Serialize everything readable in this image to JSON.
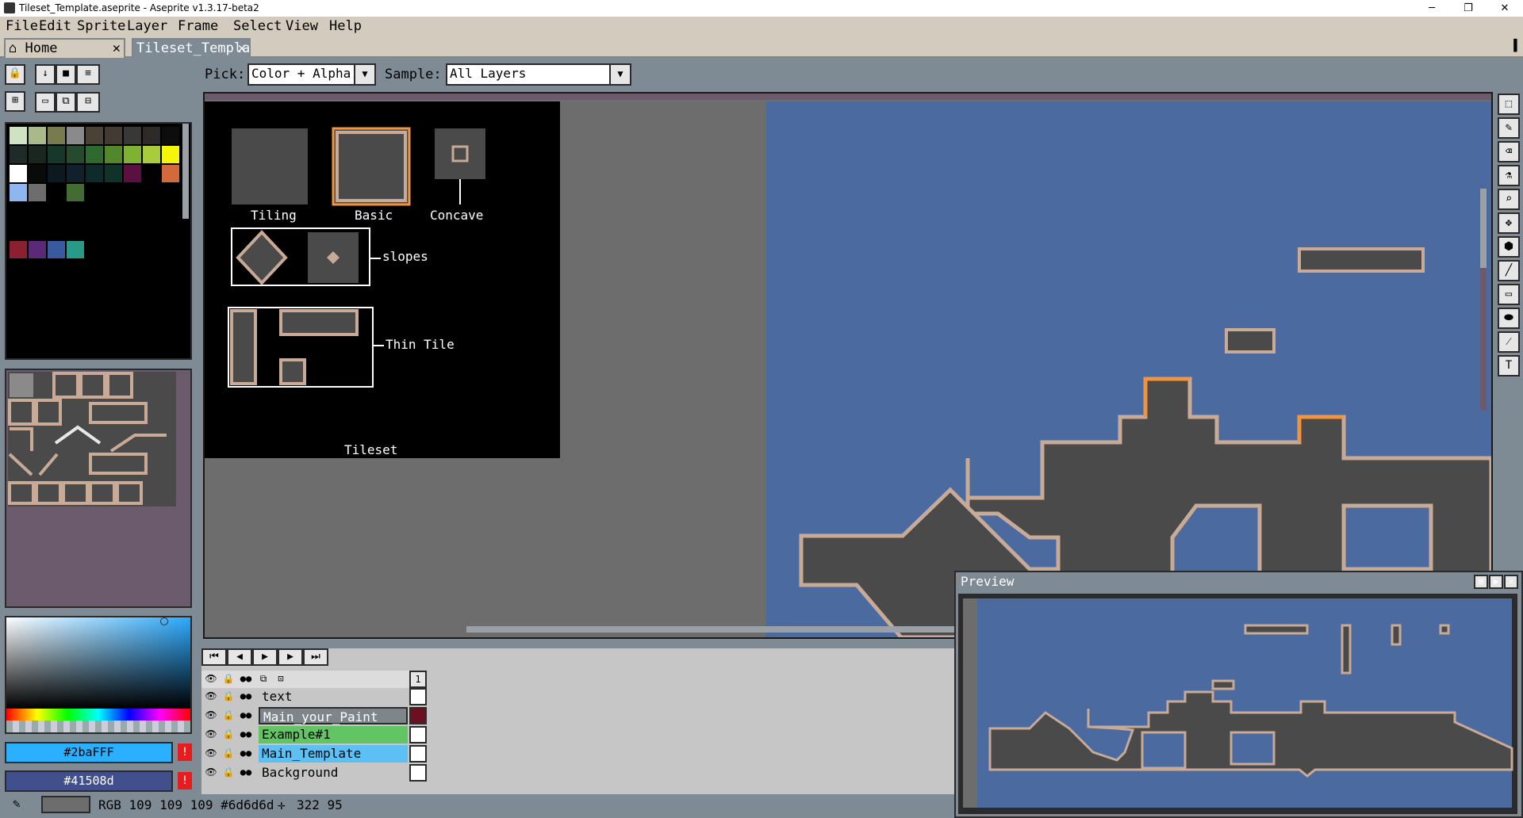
{
  "window": {
    "title": "Tileset_Template.aseprite - Aseprite v1.3.17-beta2",
    "minimize": "─",
    "maximize": "❐",
    "close": "✕"
  },
  "menu": [
    "File",
    "Edit",
    "Sprite",
    "Layer",
    "Frame",
    "Select",
    "View",
    "Help"
  ],
  "tabs": [
    {
      "label": "Home",
      "close": "✕"
    },
    {
      "label": "Tileset_Templa",
      "close": "✕"
    }
  ],
  "context_bar": {
    "pick_label": "Pick:",
    "pick_value": "Color + Alpha",
    "sample_label": "Sample:",
    "sample_value": "All Layers"
  },
  "sprite_labels": {
    "tiling": "Tiling",
    "basic": "Basic",
    "concave": "Concave",
    "slopes": "slopes",
    "thin_tile": "Thin Tile",
    "tileset": "Tileset"
  },
  "colors": {
    "sky": "#4a6aa0",
    "ground": "#4a4a4a",
    "outline": "#c8aa96",
    "orange": "#f29340",
    "fg_color": "#2baFFF",
    "bg_color": "#41508d"
  },
  "palette": {
    "fg_hex": "#2baFFF",
    "bg_hex": "#41508d",
    "warning": "!"
  },
  "timeline": {
    "frame_number": "1",
    "layers": [
      {
        "name": "text",
        "color": ""
      },
      {
        "name": "Main_your_Paint",
        "color": "#7e868c"
      },
      {
        "name": "Example#1",
        "color": "#62c462"
      },
      {
        "name": "Main_Template",
        "color": "#5cc0f5"
      },
      {
        "name": "Background",
        "color": ""
      }
    ]
  },
  "status": {
    "rgb": "RGB 109 109 109 #6d6d6d",
    "position": "322 95"
  },
  "preview": {
    "title": "Preview"
  }
}
